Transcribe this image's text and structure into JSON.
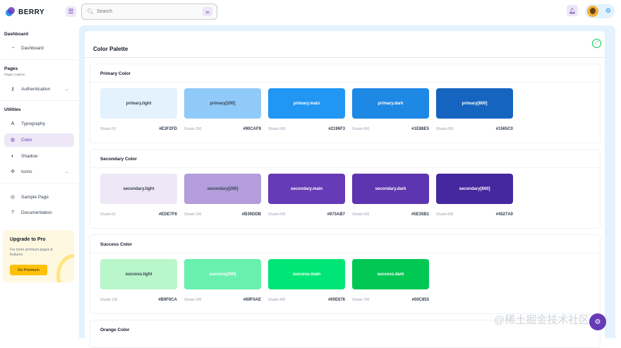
{
  "brand": {
    "name": "BERRY"
  },
  "header": {
    "search_placeholder": "Search",
    "icons": [
      "menu-icon",
      "search-icon",
      "tune-icon",
      "bell-icon",
      "settings-icon"
    ]
  },
  "sidebar": {
    "groups": [
      {
        "title": "Dashboard",
        "items": [
          {
            "label": "Dashboard",
            "icon": "dashboard-icon"
          }
        ]
      },
      {
        "title": "Pages",
        "subtitle": "Pages Caption",
        "items": [
          {
            "label": "Authentication",
            "icon": "key-icon"
          }
        ]
      },
      {
        "title": "Utilities",
        "items": [
          {
            "label": "Typography",
            "icon": "typography-icon"
          },
          {
            "label": "Color",
            "icon": "palette-icon",
            "active": true
          },
          {
            "label": "Shadow",
            "icon": "shadow-icon"
          },
          {
            "label": "Icons",
            "icon": "windmill-icon"
          }
        ]
      },
      {
        "title": "",
        "items": [
          {
            "label": "Sample Page",
            "icon": "brand-chrome-icon"
          },
          {
            "label": "Documentation",
            "icon": "help-icon"
          }
        ]
      }
    ],
    "upgrade": {
      "title": "Upgrade to Pro",
      "description": "For more premium pages & features",
      "button": "Go Premium"
    }
  },
  "page": {
    "title": "Color Palette",
    "sections": [
      {
        "title": "Primary Color",
        "swatches": [
          {
            "label": "primary.light",
            "shade": "Shade-50",
            "hex": "#E3F2FD",
            "bg": "#e3f2fd",
            "fg": "#364152"
          },
          {
            "label": "primary[200]",
            "shade": "Shade-200",
            "hex": "#90CAF9",
            "bg": "#90caf9",
            "fg": "#364152"
          },
          {
            "label": "primary.main",
            "shade": "Shade-500",
            "hex": "#2196F3",
            "bg": "#2196f3",
            "fg": "#ffffff"
          },
          {
            "label": "primary.dark",
            "shade": "Shade-600",
            "hex": "#1E88E5",
            "bg": "#1e88e5",
            "fg": "#ffffff"
          },
          {
            "label": "primary[800]",
            "shade": "Shade-800",
            "hex": "#1565C0",
            "bg": "#1565c0",
            "fg": "#ffffff"
          }
        ]
      },
      {
        "title": "Secondary Color",
        "swatches": [
          {
            "label": "secondary.light",
            "shade": "Shade-50",
            "hex": "#EDE7F6",
            "bg": "#ede7f6",
            "fg": "#364152"
          },
          {
            "label": "secondary[200]",
            "shade": "Shade-200",
            "hex": "#B39DDB",
            "bg": "#b39ddb",
            "fg": "#364152"
          },
          {
            "label": "secondary.main",
            "shade": "Shade-500",
            "hex": "#673AB7",
            "bg": "#673ab7",
            "fg": "#ffffff"
          },
          {
            "label": "secondary.dark",
            "shade": "Shade-600",
            "hex": "#5E35B1",
            "bg": "#5e35b1",
            "fg": "#ffffff"
          },
          {
            "label": "secondary[800]",
            "shade": "Shade-800",
            "hex": "#4527A0",
            "bg": "#4527a0",
            "fg": "#ffffff"
          }
        ]
      },
      {
        "title": "Success Color",
        "swatches": [
          {
            "label": "success.light",
            "shade": "Shade-100",
            "hex": "#B9F6CA",
            "bg": "#b9f6ca",
            "fg": "#364152"
          },
          {
            "label": "success[200]",
            "shade": "Shade-200",
            "hex": "#69F0AE",
            "bg": "#69f0ae",
            "fg": "#ffffff"
          },
          {
            "label": "success.main",
            "shade": "Shade-400",
            "hex": "#00E676",
            "bg": "#00e676",
            "fg": "#ffffff"
          },
          {
            "label": "success.dark",
            "shade": "Shade-700",
            "hex": "#00C853",
            "bg": "#00c853",
            "fg": "#ffffff"
          }
        ]
      },
      {
        "title": "Orange Color",
        "swatches": []
      }
    ]
  },
  "watermark": "@稀土掘金技术社区"
}
